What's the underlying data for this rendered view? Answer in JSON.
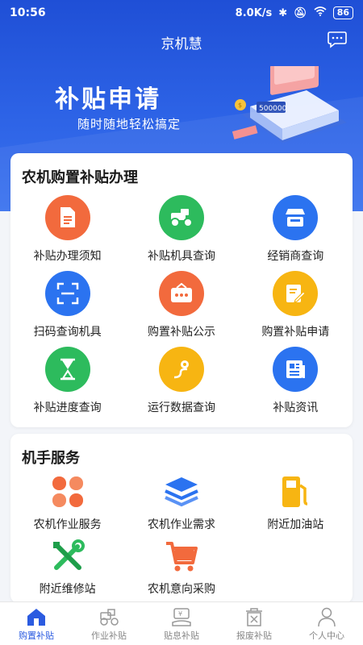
{
  "status_bar": {
    "time": "10:56",
    "speed": "8.0K/s",
    "battery": "86"
  },
  "header": {
    "title": "京机慧"
  },
  "banner": {
    "title": "补贴申请",
    "subtitle": "随时随地轻松搞定",
    "amount": "500000"
  },
  "subsidy_section": {
    "title": "农机购置补贴办理",
    "items": [
      {
        "label": "补贴办理须知",
        "icon": "document-icon",
        "color": "#f26a3d"
      },
      {
        "label": "补贴机具查询",
        "icon": "tractor-icon",
        "color": "#2dbb5d"
      },
      {
        "label": "经销商查询",
        "icon": "store-icon",
        "color": "#2b73f0"
      },
      {
        "label": "扫码查询机具",
        "icon": "scan-icon",
        "color": "#2b73f0"
      },
      {
        "label": "购置补贴公示",
        "icon": "notice-board-icon",
        "color": "#f26a3d"
      },
      {
        "label": "购置补贴申请",
        "icon": "edit-form-icon",
        "color": "#f7b512"
      },
      {
        "label": "补贴进度查询",
        "icon": "hourglass-icon",
        "color": "#2dbb5d"
      },
      {
        "label": "运行数据查询",
        "icon": "route-icon",
        "color": "#f7b512"
      },
      {
        "label": "补贴资讯",
        "icon": "news-icon",
        "color": "#2b73f0"
      }
    ]
  },
  "operator_section": {
    "title": "机手服务",
    "items": [
      {
        "label": "农机作业服务",
        "icon": "grid-petals-icon",
        "color": "#f26a3d"
      },
      {
        "label": "农机作业需求",
        "icon": "layers-icon",
        "color": "#2b73f0"
      },
      {
        "label": "附近加油站",
        "icon": "gas-station-icon",
        "color": "#f7b512"
      },
      {
        "label": "附近维修站",
        "icon": "wrench-icon",
        "color": "#2dbb5d"
      },
      {
        "label": "农机意向采购",
        "icon": "cart-icon",
        "color": "#f26a3d"
      }
    ]
  },
  "tabbar": {
    "tabs": [
      {
        "label": "购置补贴",
        "icon": "home-icon",
        "active": true
      },
      {
        "label": "作业补贴",
        "icon": "tractor-outline-icon",
        "active": false
      },
      {
        "label": "贴息补贴",
        "icon": "interest-icon",
        "active": false
      },
      {
        "label": "报废补贴",
        "icon": "scrap-bin-icon",
        "active": false
      },
      {
        "label": "个人中心",
        "icon": "user-icon",
        "active": false
      }
    ]
  },
  "colors": {
    "primary": "#2b5be0",
    "orange": "#f26a3d",
    "green": "#2dbb5d",
    "blue": "#2b73f0",
    "yellow": "#f7b512"
  }
}
